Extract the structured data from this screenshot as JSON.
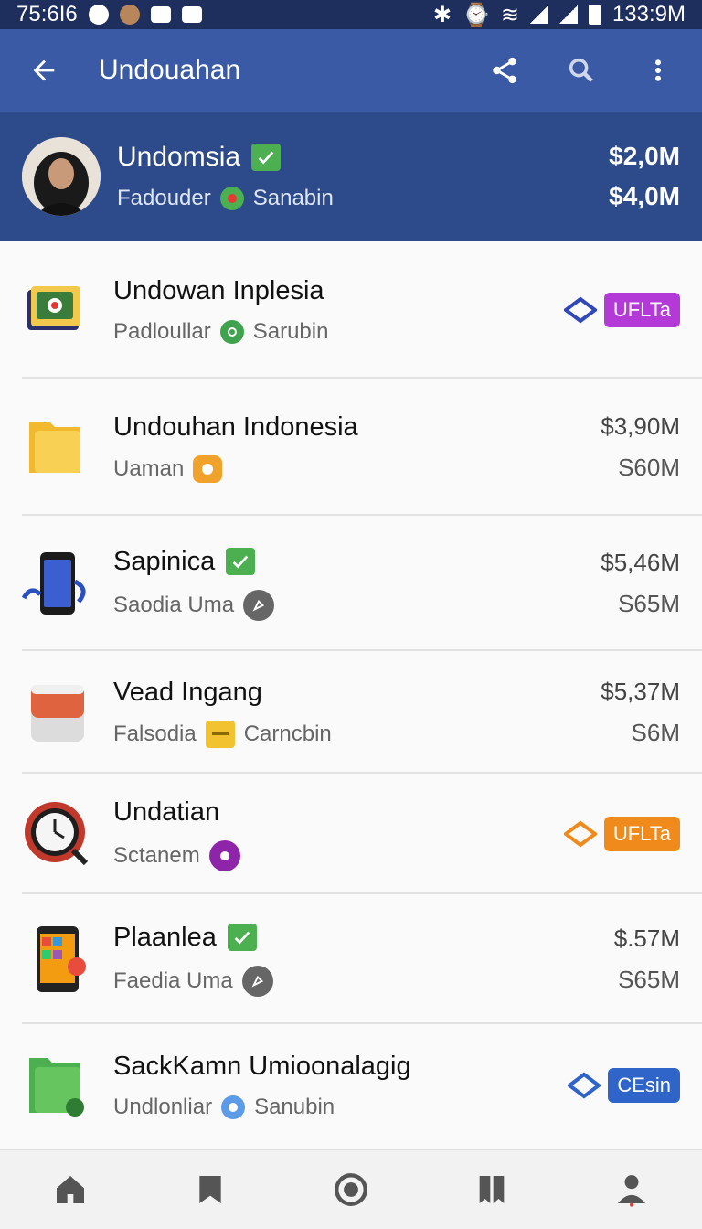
{
  "status_bar": {
    "time": "75:6I6",
    "right_text": "133:9M"
  },
  "app_bar": {
    "title": "Undouahan"
  },
  "profile": {
    "name": "Undomsia",
    "sub_left": "Fadouder",
    "sub_right": "Sanabin",
    "value1": "$2,0M",
    "value2": "$4,0M"
  },
  "items": [
    {
      "title": "Undowan Inplesia",
      "sub": "Padloullar",
      "sub2": "Sarubin",
      "tag": "UFLTa",
      "tag_color": "#b33ad6"
    },
    {
      "title": "Undouhan Indonesia",
      "sub": "Uaman",
      "value1": "$3,90M",
      "value2": "S60M"
    },
    {
      "title": "Sapinica",
      "sub": "Saodia Uma",
      "value1": "$5,46M",
      "value2": "S65M"
    },
    {
      "title": "Vead Ingang",
      "sub": "Falsodia",
      "sub2": "Carncbin",
      "value1": "$5,37M",
      "value2": "S6M"
    },
    {
      "title": "Undatian",
      "sub": "Sctanem",
      "tag": "UFLTa",
      "tag_color": "#f08a1a"
    },
    {
      "title": "Plaanlea",
      "sub": "Faedia Uma",
      "value1": "$.57M",
      "value2": "S65M"
    },
    {
      "title": "SackKamn Umioonalagig",
      "sub": "Undlonliar",
      "sub2": "Sanubin",
      "tag": "CEsin",
      "tag_color": "#2f64c9"
    }
  ],
  "icons": {
    "status": [
      "dot-icon",
      "message-icon",
      "notification-icon",
      "bluetooth-icon",
      "wifi-icon",
      "signal-icon",
      "battery-icon"
    ],
    "app_bar": [
      "back-arrow-icon",
      "share-icon",
      "search-icon",
      "more-vert-icon"
    ],
    "bottom_nav": [
      "home-icon",
      "bookmark-icon",
      "record-icon",
      "book-icon",
      "person-icon"
    ]
  },
  "colors": {
    "app_bar": "#3a5aa6",
    "profile_bg": "#2d4a8a",
    "status_bar": "#1e2f5e",
    "check_green": "#4caf50"
  }
}
